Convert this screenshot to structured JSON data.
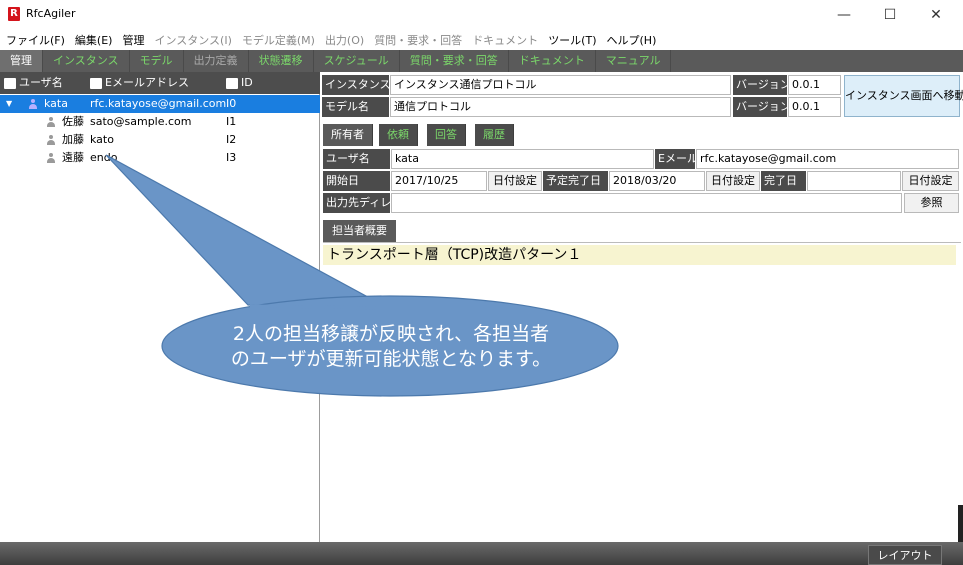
{
  "window": {
    "app_logo": "R",
    "title": "RfcAgiler",
    "minimize": "—",
    "maximize": "☐",
    "close": "✕"
  },
  "menu": [
    {
      "label": "ファイル(F)",
      "enabled": true
    },
    {
      "label": "編集(E)",
      "enabled": true
    },
    {
      "label": "管理",
      "enabled": true
    },
    {
      "label": "インスタンス(I)",
      "enabled": false
    },
    {
      "label": "モデル定義(M)",
      "enabled": false
    },
    {
      "label": "出力(O)",
      "enabled": false
    },
    {
      "label": "質問・要求・回答",
      "enabled": false
    },
    {
      "label": "ドキュメント",
      "enabled": false
    },
    {
      "label": "ツール(T)",
      "enabled": true
    },
    {
      "label": "ヘルプ(H)",
      "enabled": true
    }
  ],
  "main_tabs": [
    {
      "label": "管理",
      "state": "active"
    },
    {
      "label": "インスタンス",
      "state": "normal"
    },
    {
      "label": "モデル",
      "state": "normal"
    },
    {
      "label": "出力定義",
      "state": "dim"
    },
    {
      "label": "状態遷移",
      "state": "normal"
    },
    {
      "label": "スケジュール",
      "state": "normal"
    },
    {
      "label": "質問・要求・回答",
      "state": "normal"
    },
    {
      "label": "ドキュメント",
      "state": "normal"
    },
    {
      "label": "マニュアル",
      "state": "normal"
    }
  ],
  "tree": {
    "headers": {
      "user": "ユーザ名",
      "email": "Eメールアドレス",
      "id": "ID"
    },
    "rows": [
      {
        "name": "kata",
        "email": "rfc.katayose@gmail.com",
        "id": "I0",
        "selected": true,
        "expanded": true
      },
      {
        "name": "佐藤",
        "email": "sato@sample.com",
        "id": "I1",
        "selected": false
      },
      {
        "name": "加藤",
        "email": "kato",
        "id": "I2",
        "selected": false
      },
      {
        "name": "遠藤",
        "email": "endo",
        "id": "I3",
        "selected": false
      }
    ]
  },
  "instance": {
    "instance_label": "インスタンス名",
    "instance_value": "インスタンス通信プロトコル",
    "model_label": "モデル名",
    "model_value": "通信プロトコル",
    "version_label": "バージョン",
    "instance_version": "0.0.1",
    "model_version": "0.0.1",
    "goto_button": "インスタンス画面へ移動"
  },
  "sub_tabs": [
    {
      "label": "所有者",
      "active": true
    },
    {
      "label": "依頼",
      "active": false
    },
    {
      "label": "回答",
      "active": false
    },
    {
      "label": "履歴",
      "active": false
    }
  ],
  "owner": {
    "user_label": "ユーザ名",
    "user_value": "kata",
    "email_label": "Eメール",
    "email_value": "rfc.katayose@gmail.com",
    "start_label": "開始日",
    "start_value": "2017/10/25",
    "date_button": "日付設定",
    "planned_label": "予定完了日",
    "planned_value": "2018/03/20",
    "done_label": "完了日",
    "done_value": "",
    "outdir_label": "出力先ディレ",
    "outdir_value": "",
    "browse_button": "参照"
  },
  "overview": {
    "tab_label": "担当者概要",
    "text": "トランスポート層（TCP)改造パターン１"
  },
  "callout": {
    "line1": "2人の担当移譲が反映され、各担当者",
    "line2": "のユーザが更新可能状態となります。"
  },
  "statusbar": {
    "layout_button": "レイアウト"
  },
  "colors": {
    "selection": "#1a7ee0",
    "tab_green": "#7bd86a",
    "header_dark": "#4b4b4b",
    "callout_fill": "#6a95c7",
    "overview_bg": "#f7f4d0"
  }
}
